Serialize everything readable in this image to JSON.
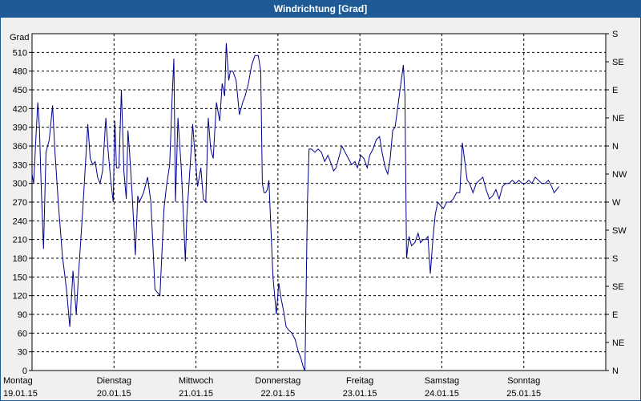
{
  "window": {
    "title": "Windrichtung [Grad]"
  },
  "chart_data": {
    "type": "line",
    "title": "Windrichtung [Grad]",
    "ylabel": "Grad",
    "ylim": [
      0,
      540
    ],
    "xlim": [
      0,
      7
    ],
    "grid": true,
    "y_ticks": [
      0,
      30,
      60,
      90,
      120,
      150,
      180,
      210,
      240,
      270,
      300,
      330,
      360,
      390,
      420,
      450,
      480,
      510
    ],
    "y2_ticks": [
      {
        "value": 0,
        "label": "N"
      },
      {
        "value": 45,
        "label": "NE"
      },
      {
        "value": 90,
        "label": "E"
      },
      {
        "value": 135,
        "label": "SE"
      },
      {
        "value": 180,
        "label": "S"
      },
      {
        "value": 225,
        "label": "SW"
      },
      {
        "value": 270,
        "label": "W"
      },
      {
        "value": 315,
        "label": "NW"
      },
      {
        "value": 360,
        "label": "N"
      },
      {
        "value": 405,
        "label": "NE"
      },
      {
        "value": 450,
        "label": "E"
      },
      {
        "value": 495,
        "label": "SE"
      },
      {
        "value": 540,
        "label": "S"
      }
    ],
    "x_ticks": [
      {
        "day": "Montag",
        "date": "19.01.15"
      },
      {
        "day": "Dienstag",
        "date": "20.01.15"
      },
      {
        "day": "Mittwoch",
        "date": "21.01.15"
      },
      {
        "day": "Donnerstag",
        "date": "22.01.15"
      },
      {
        "day": "Freitag",
        "date": "23.01.15"
      },
      {
        "day": "Samstag",
        "date": "24.01.15"
      },
      {
        "day": "Sonntag",
        "date": "25.01.15"
      }
    ],
    "line_color": "#00008b",
    "series": [
      {
        "points": [
          [
            0.0,
            315
          ],
          [
            0.02,
            300
          ],
          [
            0.05,
            380
          ],
          [
            0.07,
            430
          ],
          [
            0.09,
            390
          ],
          [
            0.11,
            300
          ],
          [
            0.14,
            195
          ],
          [
            0.17,
            350
          ],
          [
            0.21,
            370
          ],
          [
            0.25,
            425
          ],
          [
            0.28,
            350
          ],
          [
            0.32,
            270
          ],
          [
            0.37,
            185
          ],
          [
            0.42,
            130
          ],
          [
            0.46,
            70
          ],
          [
            0.5,
            160
          ],
          [
            0.54,
            90
          ],
          [
            0.57,
            160
          ],
          [
            0.62,
            260
          ],
          [
            0.66,
            350
          ],
          [
            0.68,
            395
          ],
          [
            0.71,
            340
          ],
          [
            0.74,
            330
          ],
          [
            0.77,
            335
          ],
          [
            0.8,
            310
          ],
          [
            0.83,
            300
          ],
          [
            0.86,
            320
          ],
          [
            0.9,
            405
          ],
          [
            0.93,
            350
          ],
          [
            0.96,
            305
          ],
          [
            0.99,
            270
          ],
          [
            1.01,
            400
          ],
          [
            1.03,
            325
          ],
          [
            1.06,
            325
          ],
          [
            1.09,
            450
          ],
          [
            1.12,
            320
          ],
          [
            1.15,
            275
          ],
          [
            1.17,
            385
          ],
          [
            1.19,
            350
          ],
          [
            1.22,
            285
          ],
          [
            1.26,
            185
          ],
          [
            1.29,
            280
          ],
          [
            1.31,
            270
          ],
          [
            1.36,
            285
          ],
          [
            1.41,
            310
          ],
          [
            1.45,
            270
          ],
          [
            1.5,
            130
          ],
          [
            1.56,
            120
          ],
          [
            1.61,
            260
          ],
          [
            1.64,
            295
          ],
          [
            1.68,
            330
          ],
          [
            1.71,
            440
          ],
          [
            1.73,
            500
          ],
          [
            1.75,
            270
          ],
          [
            1.78,
            405
          ],
          [
            1.82,
            325
          ],
          [
            1.85,
            240
          ],
          [
            1.87,
            175
          ],
          [
            1.89,
            250
          ],
          [
            1.91,
            290
          ],
          [
            1.94,
            350
          ],
          [
            1.96,
            395
          ],
          [
            1.98,
            360
          ],
          [
            2.02,
            295
          ],
          [
            2.06,
            325
          ],
          [
            2.09,
            275
          ],
          [
            2.12,
            270
          ],
          [
            2.15,
            405
          ],
          [
            2.18,
            355
          ],
          [
            2.21,
            340
          ],
          [
            2.25,
            430
          ],
          [
            2.29,
            400
          ],
          [
            2.32,
            460
          ],
          [
            2.35,
            440
          ],
          [
            2.37,
            525
          ],
          [
            2.4,
            465
          ],
          [
            2.42,
            480
          ],
          [
            2.45,
            480
          ],
          [
            2.49,
            465
          ],
          [
            2.53,
            410
          ],
          [
            2.57,
            430
          ],
          [
            2.6,
            440
          ],
          [
            2.64,
            460
          ],
          [
            2.68,
            490
          ],
          [
            2.72,
            505
          ],
          [
            2.76,
            505
          ],
          [
            2.79,
            480
          ],
          [
            2.81,
            300
          ],
          [
            2.83,
            285
          ],
          [
            2.85,
            285
          ],
          [
            2.87,
            290
          ],
          [
            2.89,
            305
          ],
          [
            2.91,
            240
          ],
          [
            2.94,
            150
          ],
          [
            2.96,
            120
          ],
          [
            2.98,
            90
          ],
          [
            3.01,
            140
          ],
          [
            3.04,
            115
          ],
          [
            3.07,
            95
          ],
          [
            3.1,
            70
          ],
          [
            3.13,
            65
          ],
          [
            3.17,
            60
          ],
          [
            3.21,
            50
          ],
          [
            3.25,
            30
          ],
          [
            3.28,
            20
          ],
          [
            3.31,
            5
          ],
          [
            3.33,
            0
          ],
          [
            3.36,
            270
          ],
          [
            3.38,
            355
          ],
          [
            3.41,
            355
          ],
          [
            3.45,
            350
          ],
          [
            3.49,
            355
          ],
          [
            3.53,
            350
          ],
          [
            3.57,
            335
          ],
          [
            3.61,
            345
          ],
          [
            3.64,
            335
          ],
          [
            3.68,
            320
          ],
          [
            3.71,
            325
          ],
          [
            3.75,
            345
          ],
          [
            3.78,
            360
          ],
          [
            3.82,
            350
          ],
          [
            3.86,
            340
          ],
          [
            3.9,
            330
          ],
          [
            3.94,
            335
          ],
          [
            3.97,
            325
          ],
          [
            4.01,
            345
          ],
          [
            4.05,
            340
          ],
          [
            4.09,
            325
          ],
          [
            4.12,
            345
          ],
          [
            4.16,
            355
          ],
          [
            4.2,
            370
          ],
          [
            4.24,
            375
          ],
          [
            4.27,
            350
          ],
          [
            4.31,
            325
          ],
          [
            4.34,
            315
          ],
          [
            4.37,
            340
          ],
          [
            4.4,
            385
          ],
          [
            4.43,
            390
          ],
          [
            4.46,
            420
          ],
          [
            4.5,
            460
          ],
          [
            4.53,
            490
          ],
          [
            4.55,
            440
          ],
          [
            4.57,
            180
          ],
          [
            4.6,
            215
          ],
          [
            4.63,
            200
          ],
          [
            4.67,
            205
          ],
          [
            4.71,
            220
          ],
          [
            4.74,
            205
          ],
          [
            4.77,
            210
          ],
          [
            4.8,
            210
          ],
          [
            4.83,
            215
          ],
          [
            4.86,
            155
          ],
          [
            4.89,
            210
          ],
          [
            4.92,
            250
          ],
          [
            4.95,
            270
          ],
          [
            4.98,
            265
          ],
          [
            5.02,
            260
          ],
          [
            5.06,
            270
          ],
          [
            5.1,
            270
          ],
          [
            5.14,
            275
          ],
          [
            5.18,
            285
          ],
          [
            5.22,
            285
          ],
          [
            5.25,
            365
          ],
          [
            5.28,
            335
          ],
          [
            5.31,
            305
          ],
          [
            5.34,
            300
          ],
          [
            5.38,
            285
          ],
          [
            5.42,
            300
          ],
          [
            5.46,
            305
          ],
          [
            5.5,
            310
          ],
          [
            5.54,
            290
          ],
          [
            5.58,
            275
          ],
          [
            5.62,
            280
          ],
          [
            5.66,
            290
          ],
          [
            5.7,
            275
          ],
          [
            5.74,
            295
          ],
          [
            5.78,
            300
          ],
          [
            5.82,
            300
          ],
          [
            5.86,
            305
          ],
          [
            5.9,
            300
          ],
          [
            5.94,
            305
          ],
          [
            5.98,
            300
          ],
          [
            6.02,
            300
          ],
          [
            6.06,
            305
          ],
          [
            6.1,
            300
          ],
          [
            6.14,
            310
          ],
          [
            6.18,
            305
          ],
          [
            6.22,
            300
          ],
          [
            6.26,
            300
          ],
          [
            6.3,
            305
          ],
          [
            6.34,
            295
          ],
          [
            6.37,
            285
          ],
          [
            6.4,
            290
          ],
          [
            6.43,
            295
          ]
        ]
      }
    ]
  }
}
